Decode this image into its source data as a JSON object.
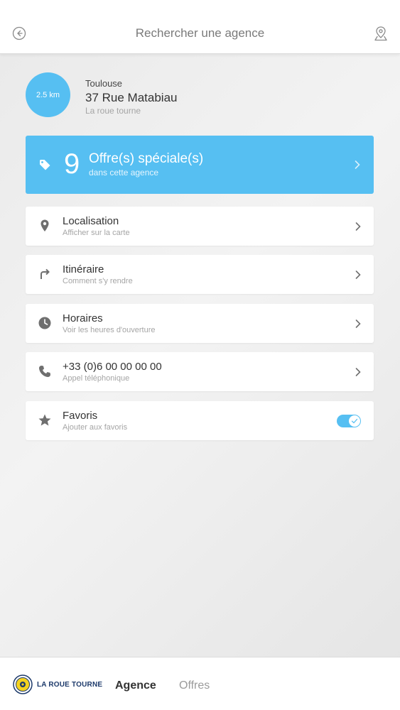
{
  "header": {
    "title": "Rechercher une agence",
    "back_icon": "back-circle-icon",
    "map_icon": "map-pin-icon"
  },
  "agency": {
    "distance": "2.5 km",
    "city": "Toulouse",
    "street": "37 Rue Matabiau",
    "brand": "La roue tourne"
  },
  "offers": {
    "count": "9",
    "label": "Offre(s) spéciale(s)",
    "sub": "dans cette agence",
    "icon": "tag-icon"
  },
  "rows": [
    {
      "label": "Localisation",
      "sub": "Afficher sur la carte",
      "icon": "location-pin-icon"
    },
    {
      "label": "Itinéraire",
      "sub": "Comment s'y rendre",
      "icon": "turn-right-arrow-icon"
    },
    {
      "label": "Horaires",
      "sub": "Voir les heures d'ouverture",
      "icon": "clock-icon"
    },
    {
      "label": "+33 (0)6 00 00 00 00",
      "sub": "Appel téléphonique",
      "icon": "phone-icon"
    },
    {
      "label": "Favoris",
      "sub": "Ajouter aux favoris",
      "icon": "star-icon",
      "toggle_on": true
    }
  ],
  "footer": {
    "logo_text": "LA ROUE TOURNE",
    "tabs": [
      {
        "label": "Agence",
        "active": true
      },
      {
        "label": "Offres",
        "active": false
      }
    ]
  },
  "colors": {
    "accent": "#56bff2",
    "icon_gray": "#6f6f6f"
  }
}
